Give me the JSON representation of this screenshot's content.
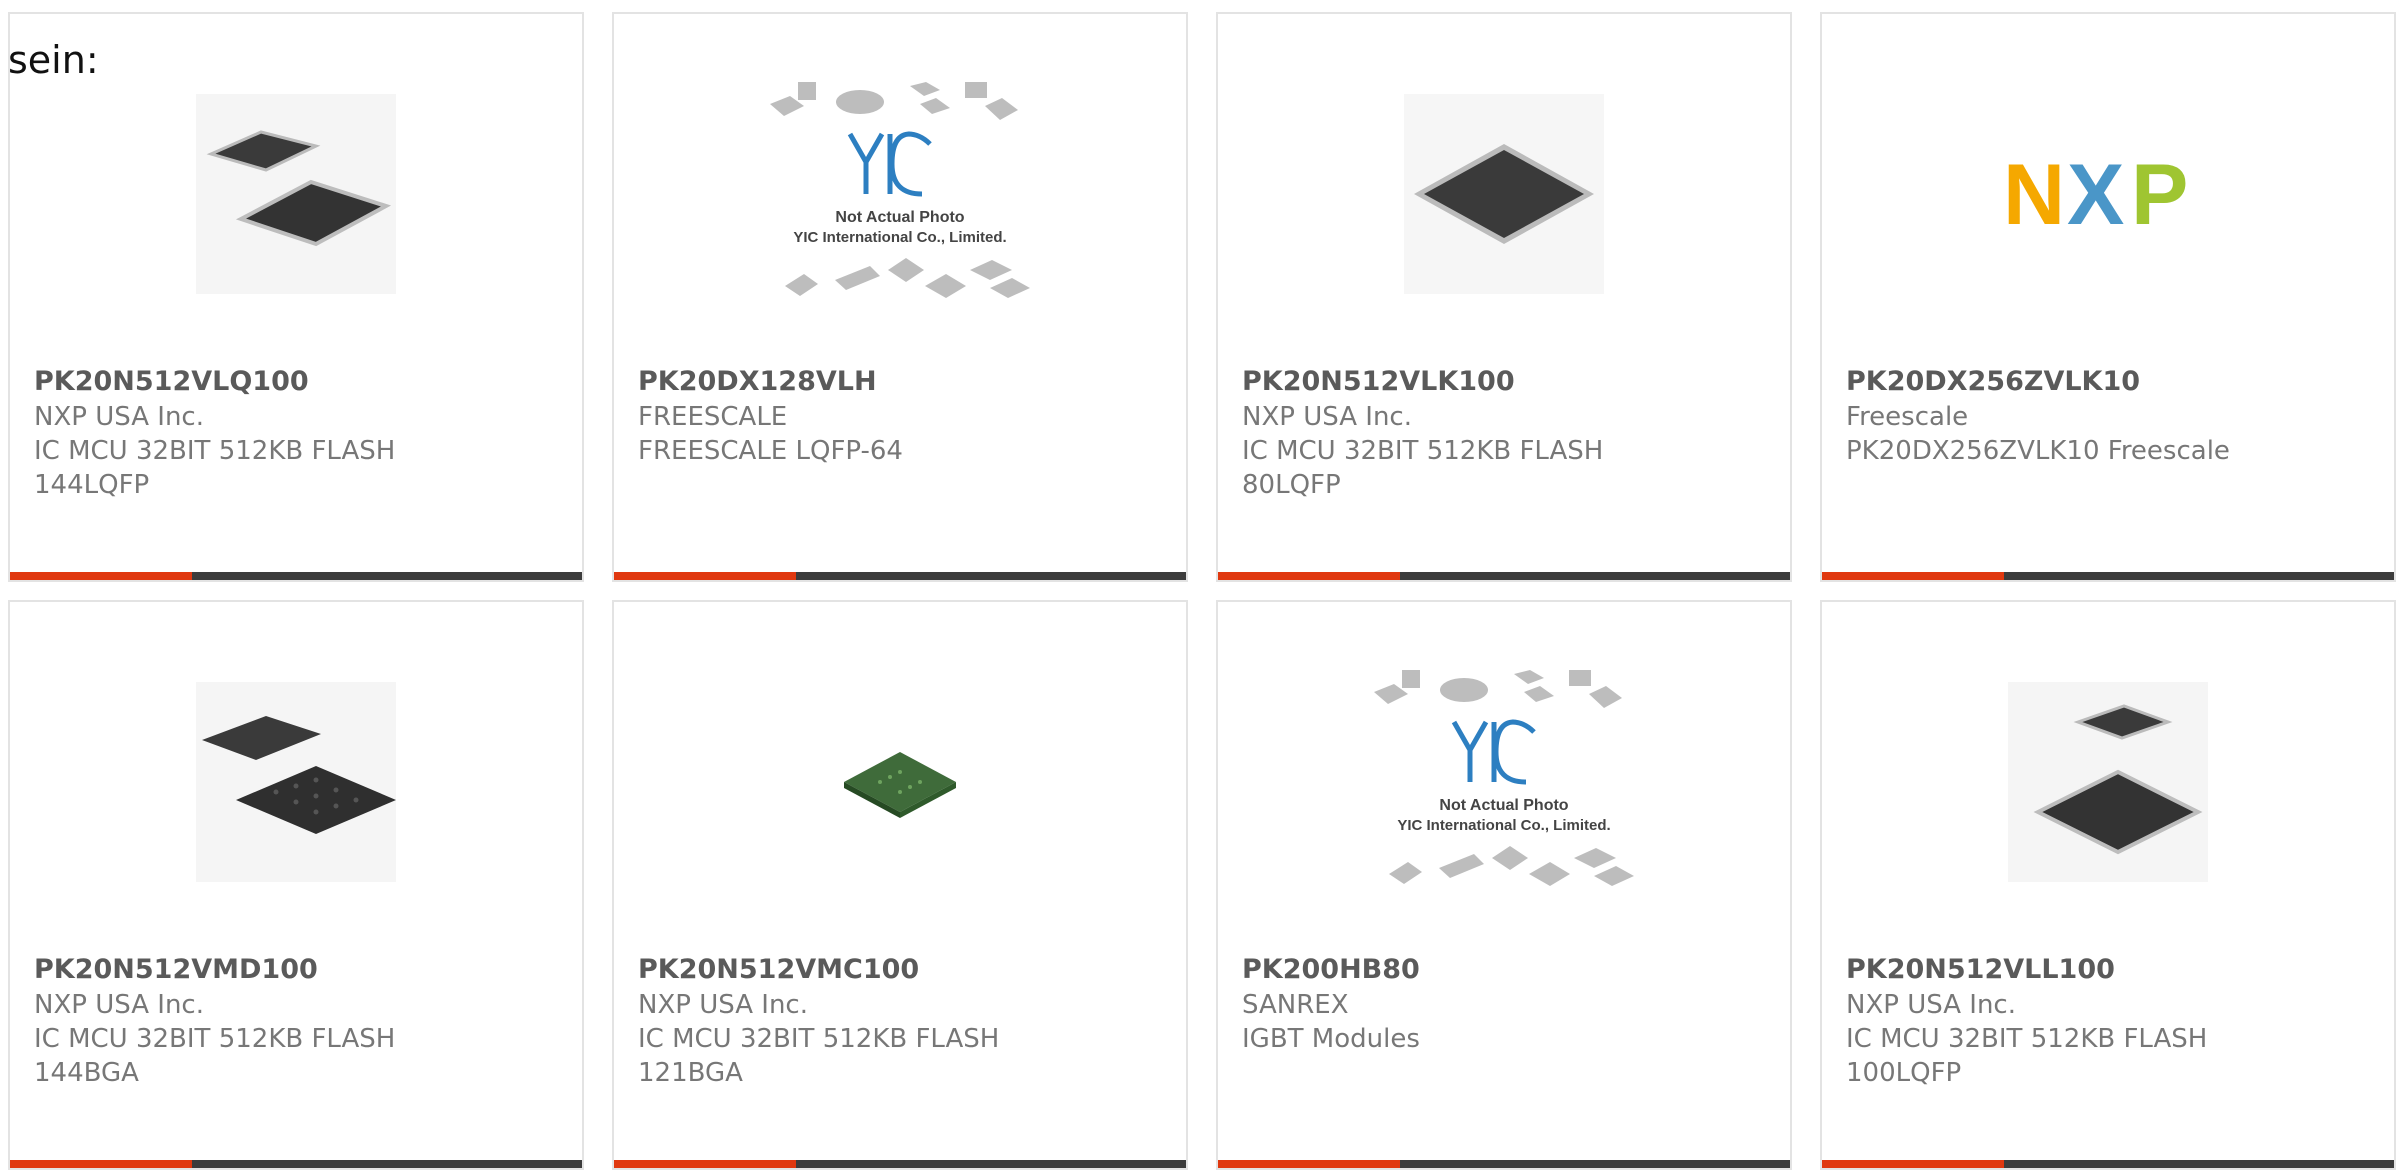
{
  "page": {
    "intro_text": "sein:"
  },
  "products": [
    {
      "part": "PK20N512VLQ100",
      "maker": "NXP USA Inc.",
      "description": "IC MCU 32BIT 512KB FLASH",
      "package": "144LQFP",
      "image": "lqfp-two-chips"
    },
    {
      "part": "PK20DX128VLH",
      "maker": "FREESCALE",
      "description": "FREESCALE LQFP-64",
      "package": "",
      "image": "placeholder-photo",
      "placeholder_line1": "Not Actual Photo",
      "placeholder_line2": "YIC International Co., Limited."
    },
    {
      "part": "PK20N512VLK100",
      "maker": "NXP USA Inc.",
      "description": "IC MCU 32BIT 512KB FLASH",
      "package": "80LQFP",
      "image": "lqfp-single-chip"
    },
    {
      "part": "PK20DX256ZVLK10",
      "maker": "Freescale",
      "description": "PK20DX256ZVLK10 Freescale",
      "package": "",
      "image": "nxp-logo",
      "logo_letters": [
        "N",
        "X",
        "P"
      ]
    },
    {
      "part": "PK20N512VMD100",
      "maker": "NXP USA Inc.",
      "description": "IC MCU 32BIT 512KB FLASH",
      "package": "144BGA",
      "image": "bga-two-chips"
    },
    {
      "part": "PK20N512VMC100",
      "maker": "NXP USA Inc.",
      "description": "IC MCU 32BIT 512KB FLASH",
      "package": "121BGA",
      "image": "bga-green-chip"
    },
    {
      "part": "PK200HB80",
      "maker": "SANREX",
      "description": "IGBT Modules",
      "package": "",
      "image": "placeholder-photo",
      "placeholder_line1": "Not Actual Photo",
      "placeholder_line2": "YIC International Co., Limited."
    },
    {
      "part": "PK20N512VLL100",
      "maker": "NXP USA Inc.",
      "description": "IC MCU 32BIT 512KB FLASH",
      "package": "100LQFP",
      "image": "lqfp-two-chips"
    }
  ],
  "colors": {
    "accent": "#e0380f",
    "bar": "#3c3c3c",
    "border": "#e3e3e3",
    "nxp_n": "#f5a800",
    "nxp_x": "#4a96c8",
    "nxp_p": "#9fc531"
  }
}
